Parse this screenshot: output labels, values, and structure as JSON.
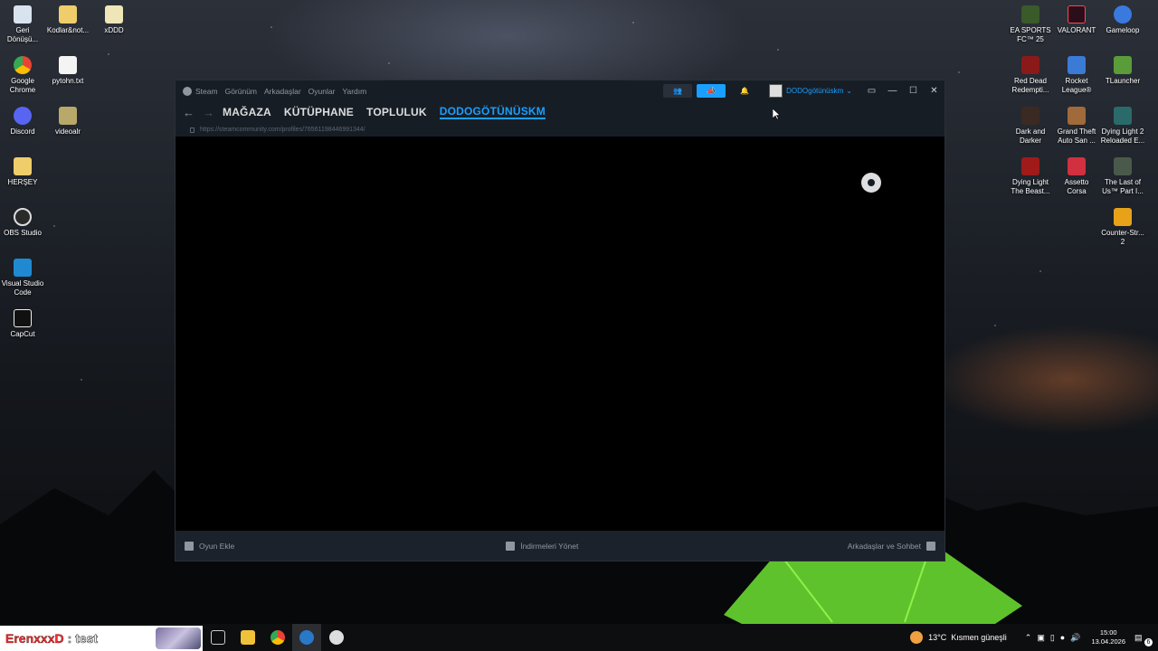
{
  "desktop_left": [
    {
      "label": "Geri\nDönüşü...",
      "icon": "recycle-bin-icon"
    },
    {
      "label": "Kodlar&not...",
      "icon": "folder-icon"
    },
    {
      "label": "xDDD",
      "icon": "file-icon"
    },
    {
      "label": "Google\nChrome",
      "icon": "chrome-icon"
    },
    {
      "label": "pytohn.txt",
      "icon": "text-file-icon"
    },
    {
      "label": "Discord",
      "icon": "discord-icon"
    },
    {
      "label": "videoalr",
      "icon": "folder-icon"
    },
    {
      "label": "HERŞEY",
      "icon": "folder-icon"
    },
    {
      "label": "OBS Studio",
      "icon": "obs-icon"
    },
    {
      "label": "Visual Studio\nCode",
      "icon": "vscode-icon"
    },
    {
      "label": "CapCut",
      "icon": "capcut-icon"
    }
  ],
  "desktop_right": [
    {
      "label": "EA SPORTS\nFC™ 25",
      "icon": "game-icon"
    },
    {
      "label": "VALORANT",
      "icon": "valorant-icon"
    },
    {
      "label": "Gameloop",
      "icon": "gameloop-icon"
    },
    {
      "label": "Red Dead\nRedempti...",
      "icon": "game-icon"
    },
    {
      "label": "Rocket\nLeague®",
      "icon": "game-icon"
    },
    {
      "label": "TLauncher",
      "icon": "minecraft-icon"
    },
    {
      "label": "Dark and\nDarker",
      "icon": "game-icon"
    },
    {
      "label": "Grand Theft\nAuto San ...",
      "icon": "game-icon"
    },
    {
      "label": "Dying Light 2\nReloaded E...",
      "icon": "game-icon"
    },
    {
      "label": "Dying Light\nThe Beast...",
      "icon": "game-icon"
    },
    {
      "label": "Assetto Corsa",
      "icon": "game-icon"
    },
    {
      "label": "The Last of\nUs™ Part I...",
      "icon": "game-icon"
    },
    {
      "label": "Counter-Str...\n2",
      "icon": "cs2-icon"
    }
  ],
  "steam": {
    "menu": [
      "Steam",
      "Görünüm",
      "Arkadaşlar",
      "Oyunlar",
      "Yardım"
    ],
    "account_name": "DODOgötünüskm",
    "tabs": [
      "MAĞAZA",
      "KÜTÜPHANE",
      "TOPLULUK",
      "DODOGÖTÜNÜSKM"
    ],
    "url": "https://steamcommunity.com/profiles/76561198446991344/",
    "add_game": "Oyun Ekle",
    "manage_downloads": "İndirmeleri Yönet",
    "friends_chat": "Arkadaşlar ve Sohbet"
  },
  "taskbar": {
    "overlay_name": "ErenxxxD",
    "overlay_text": ": test",
    "weather_temp": "13°C",
    "weather_desc": "Kısmen güneşli",
    "time": "15:00",
    "date": "13.04.2026",
    "notification_count": "6"
  }
}
